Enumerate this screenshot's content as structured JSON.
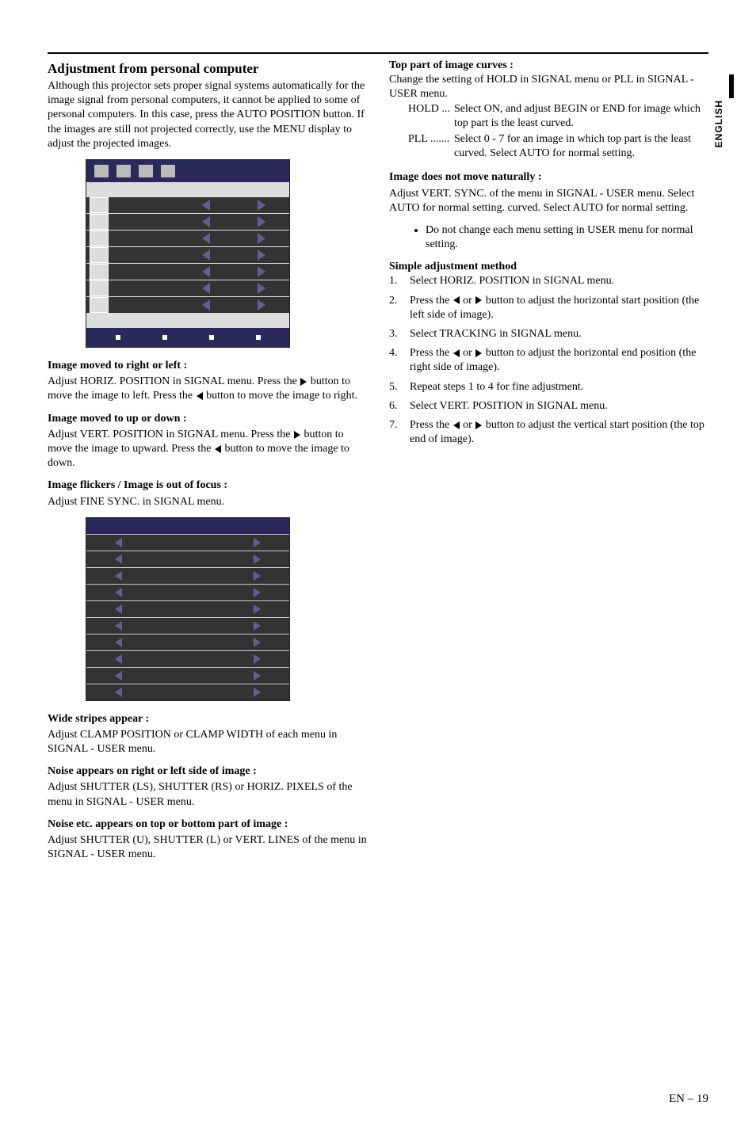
{
  "side_label": "ENGLISH",
  "left": {
    "title": "Adjustment from personal computer",
    "intro": "Although this projector sets proper signal systems automatically for the image signal from personal computers, it cannot be applied to some of personal computers.  In this case, press the AUTO POSITION button.  If the images are still not projected correctly, use the MENU display to adjust the projected images.",
    "sec1_head": "Image moved to right or left :",
    "sec1_a": "Adjust HORIZ. POSITION in SIGNAL menu.  Press the ",
    "sec1_b": " button to move the image to left.  Press the ",
    "sec1_c": " button to move the image to right.",
    "sec2_head": "Image moved to up or down :",
    "sec2_a": "Adjust VERT. POSITION in SIGNAL menu.  Press the ",
    "sec2_b": " button to move the image to upward.  Press the ",
    "sec2_c": " button to move the image to down.",
    "sec3_head": "Image flickers / Image is out of focus :",
    "sec3_a": "Adjust FINE SYNC. in SIGNAL menu.",
    "sec4_head": "Wide stripes appear :",
    "sec4_a": "Adjust CLAMP POSITION or CLAMP WIDTH of each menu in SIGNAL - USER menu.",
    "sec5_head": "Noise appears on right or left side of image :",
    "sec5_a": "Adjust SHUTTER (LS), SHUTTER (RS) or  HORIZ. PIXELS  of the menu in SIGNAL - USER menu.",
    "sec6_head": "Noise etc. appears on top or bottom part of image :",
    "sec6_a": "Adjust SHUTTER (U), SHUTTER (L) or VERT. LINES of the menu in SIGNAL - USER menu."
  },
  "right": {
    "sec1_head": "Top part of image curves :",
    "sec1_a": "Change the setting of HOLD in SIGNAL menu or PLL in SIGNAL - USER menu.",
    "dl": [
      {
        "term": "HOLD ...",
        "def": "Select ON, and adjust BEGIN or END for image which top part is the least curved."
      },
      {
        "term": "PLL .......",
        "def": "Select 0 - 7 for an image in which top part is the least curved.  Select AUTO for normal setting."
      }
    ],
    "sec2_head": "Image does not move naturally :",
    "sec2_a": "Adjust VERT. SYNC. of the menu in SIGNAL - USER menu.  Select AUTO for normal setting. curved.  Select AUTO for normal setting.",
    "bullet": "Do not change each menu setting in USER menu for normal setting.",
    "sec3_head": "Simple adjustment method",
    "steps": [
      {
        "n": "1.",
        "a": "Select HORIZ. POSITION in SIGNAL menu.",
        "arrows": false
      },
      {
        "n": "2.",
        "a": "Press the",
        "b": "or",
        "c": "button to adjust the horizontal start position (the left side of image).",
        "arrows": true
      },
      {
        "n": "3.",
        "a": "Select TRACKING in SIGNAL menu.",
        "arrows": false
      },
      {
        "n": "4.",
        "a": "Press the",
        "b": "or",
        "c": "button to adjust the horizontal end position (the right side of image).",
        "arrows": true
      },
      {
        "n": "5.",
        "a": "Repeat steps 1 to 4 for fine adjustment.",
        "arrows": false
      },
      {
        "n": "6.",
        "a": "Select VERT. POSITION in SIGNAL menu.",
        "arrows": false
      },
      {
        "n": "7.",
        "a": "Press the",
        "b": "or",
        "c": "button to adjust the vertical start position (the top end of image).",
        "arrows": true
      }
    ]
  },
  "footer": "EN – 19"
}
